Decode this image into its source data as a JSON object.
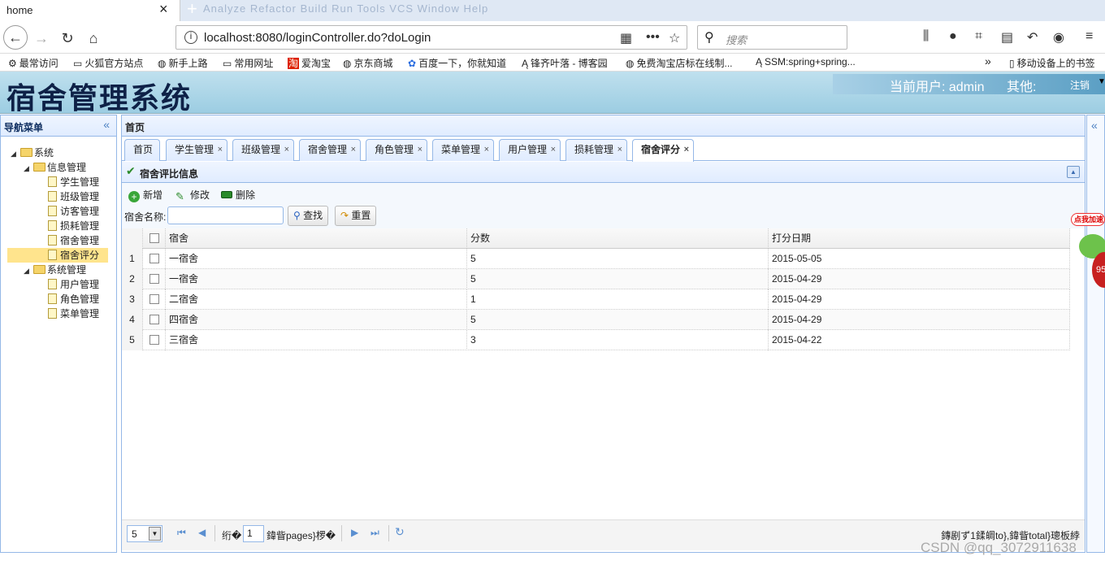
{
  "browser": {
    "tab_title": "home",
    "ghost_menu": "Analyze  Refactor  Build  Run  Tools  VCS  Window  Help",
    "url": "localhost:8080/loginController.do?doLogin",
    "search_placeholder": "搜索",
    "bookmarks": [
      "最常访问",
      "火狐官方站点",
      "新手上路",
      "常用网址",
      "爱淘宝",
      "京东商城",
      "百度一下，你就知道",
      "锋齐叶落 - 博客园",
      "免费淘宝店标在线制...",
      "SSM:spring+spring...",
      "移动设备上的书签"
    ]
  },
  "app": {
    "title": "宿舍管理系统",
    "current_user_label": "当前用户: admin",
    "other_label": "其他:",
    "logout_label": "注销"
  },
  "nav": {
    "title": "导航菜单",
    "tree": [
      {
        "label": "系统",
        "level": 0,
        "type": "folder"
      },
      {
        "label": "信息管理",
        "level": 1,
        "type": "folder"
      },
      {
        "label": "学生管理",
        "level": 2,
        "type": "file"
      },
      {
        "label": "班级管理",
        "level": 2,
        "type": "file"
      },
      {
        "label": "访客管理",
        "level": 2,
        "type": "file"
      },
      {
        "label": "损耗管理",
        "level": 2,
        "type": "file"
      },
      {
        "label": "宿舍管理",
        "level": 2,
        "type": "file"
      },
      {
        "label": "宿舍评分",
        "level": 2,
        "type": "file",
        "selected": true
      },
      {
        "label": "系统管理",
        "level": 1,
        "type": "folder"
      },
      {
        "label": "用户管理",
        "level": 2,
        "type": "file"
      },
      {
        "label": "角色管理",
        "level": 2,
        "type": "file"
      },
      {
        "label": "菜单管理",
        "level": 2,
        "type": "file"
      }
    ]
  },
  "main": {
    "title": "首页",
    "tabs": [
      {
        "label": "首页",
        "closable": false
      },
      {
        "label": "学生管理",
        "closable": true
      },
      {
        "label": "班级管理",
        "closable": true
      },
      {
        "label": "宿舍管理",
        "closable": true
      },
      {
        "label": "角色管理",
        "closable": true
      },
      {
        "label": "菜单管理",
        "closable": true
      },
      {
        "label": "用户管理",
        "closable": true
      },
      {
        "label": "损耗管理",
        "closable": true
      },
      {
        "label": "宿舍评分",
        "closable": true,
        "active": true
      }
    ],
    "panel_title": "宿舍评比信息",
    "toolbar": {
      "add": "新增",
      "edit": "修改",
      "delete": "删除"
    },
    "search": {
      "label": "宿舍名称:",
      "value": "",
      "find": "查找",
      "reset": "重置"
    },
    "grid": {
      "columns": [
        "宿舍",
        "分数",
        "打分日期"
      ],
      "rows": [
        {
          "n": "1",
          "dorm": "一宿舍",
          "score": "5",
          "date": "2015-05-05"
        },
        {
          "n": "2",
          "dorm": "一宿舍",
          "score": "5",
          "date": "2015-04-29"
        },
        {
          "n": "3",
          "dorm": "二宿舍",
          "score": "1",
          "date": "2015-04-29"
        },
        {
          "n": "4",
          "dorm": "四宿舍",
          "score": "5",
          "date": "2015-04-29"
        },
        {
          "n": "5",
          "dorm": "三宿舍",
          "score": "3",
          "date": "2015-04-22"
        }
      ]
    },
    "pager": {
      "page_size": "5",
      "before_page": "绗�",
      "page_number": "1",
      "after_page": "鍏眥pages}椤�",
      "info": "鏄剧ず1鍒皗to},鍏眥total}璁板綍"
    }
  },
  "overlay": {
    "ad_text": "点我加速",
    "ad_number": "95"
  },
  "watermark": "CSDN @qq_3072911638",
  "colors": {
    "header_bg": "#a8d4e6",
    "panel_border": "#95b8e7",
    "selected_node": "#ffe48d",
    "title_color": "#0e2147"
  }
}
